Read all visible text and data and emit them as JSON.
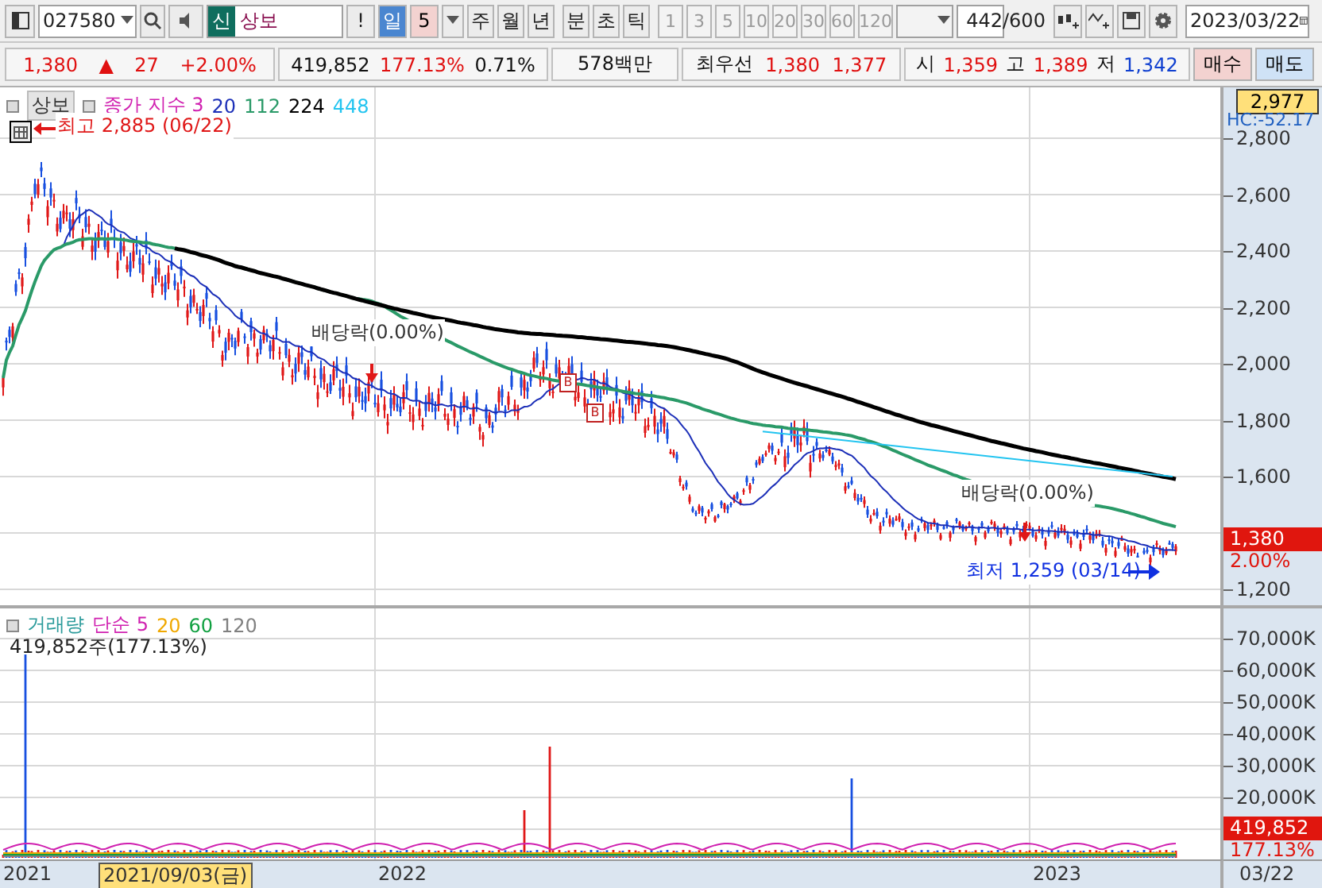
{
  "toolbar": {
    "code": "027580",
    "market_badge": "신",
    "name": "상보",
    "alert": "!",
    "periods": [
      {
        "label": "일",
        "selected": true
      },
      {
        "label": "주",
        "selected": false
      },
      {
        "label": "월",
        "selected": false
      },
      {
        "label": "년",
        "selected": false
      },
      {
        "label": "분",
        "selected": false
      },
      {
        "label": "초",
        "selected": false
      },
      {
        "label": "틱",
        "selected": false
      }
    ],
    "period_count": "5",
    "minutes": [
      "1",
      "3",
      "5",
      "10",
      "20",
      "30",
      "60",
      "120"
    ],
    "bar_count": "442",
    "bar_total": "/600",
    "date": "2023/03/22"
  },
  "quote_bar": {
    "groups": [
      [
        {
          "text": "1,380",
          "kind": "up"
        },
        {
          "text": "▲",
          "kind": "up"
        },
        {
          "text": "27",
          "kind": "up"
        },
        {
          "text": "+2.00%",
          "kind": "up"
        }
      ],
      [
        {
          "text": "419,852",
          "kind": "plain"
        },
        {
          "text": "177.13%",
          "kind": "up"
        },
        {
          "text": "0.71%",
          "kind": "plain"
        }
      ],
      [
        {
          "text": "578백만",
          "kind": "plain"
        }
      ],
      [
        {
          "text": "최우선",
          "kind": "plain"
        },
        {
          "text": "1,380",
          "kind": "up"
        },
        {
          "text": "1,377",
          "kind": "up"
        }
      ],
      [
        {
          "text": "시",
          "kind": "plain"
        },
        {
          "text": "1,359",
          "kind": "up"
        },
        {
          "text": "고",
          "kind": "plain"
        },
        {
          "text": "1,389",
          "kind": "up"
        },
        {
          "text": "저",
          "kind": "plain"
        },
        {
          "text": "1,342",
          "kind": "down"
        }
      ]
    ],
    "buy": "매수",
    "sell": "매도"
  },
  "price_pane": {
    "title": "상보",
    "indicator": "종가 지수 3",
    "periods": [
      {
        "text": "20",
        "color": "#1c2fb8"
      },
      {
        "text": "112",
        "color": "#2a9a68"
      },
      {
        "text": "224",
        "color": "#000000"
      },
      {
        "text": "448",
        "color": "#22c4f0"
      }
    ],
    "high_note": "최고 2,885 (06/22)",
    "low_note": "최저 1,259 (03/14)",
    "dividends": [
      "배당락(0.00%)",
      "배당락(0.00%)"
    ],
    "markers": [
      "B",
      "B"
    ]
  },
  "price_axis": {
    "top_value": "2,977",
    "hc": "HC:-52.17",
    "ticks": [
      "2,800",
      "2,600",
      "2,400",
      "2,200",
      "2,000",
      "1,800",
      "1,600",
      "1,200"
    ],
    "current": "1,380",
    "change": "2.00%"
  },
  "volume_pane": {
    "title": "거래량",
    "indicator": "단순 5",
    "periods": [
      {
        "text": "20",
        "color": "#f0a800"
      },
      {
        "text": "60",
        "color": "#10a040"
      },
      {
        "text": "120",
        "color": "#808080"
      }
    ],
    "reading": "419,852주(177.13%)"
  },
  "volume_axis": {
    "ticks": [
      "70,000K",
      "60,000K",
      "50,000K",
      "40,000K",
      "30,000K",
      "20,000K"
    ],
    "current": "419,852",
    "change": "177.13%"
  },
  "date_axis": {
    "labels": [
      {
        "text": "2021",
        "kind": "tick"
      },
      {
        "text": "2021/09/03(금)",
        "kind": "cursor"
      },
      {
        "text": "2022",
        "kind": "tick"
      },
      {
        "text": "2023",
        "kind": "tick"
      }
    ],
    "last": "03/22"
  }
}
